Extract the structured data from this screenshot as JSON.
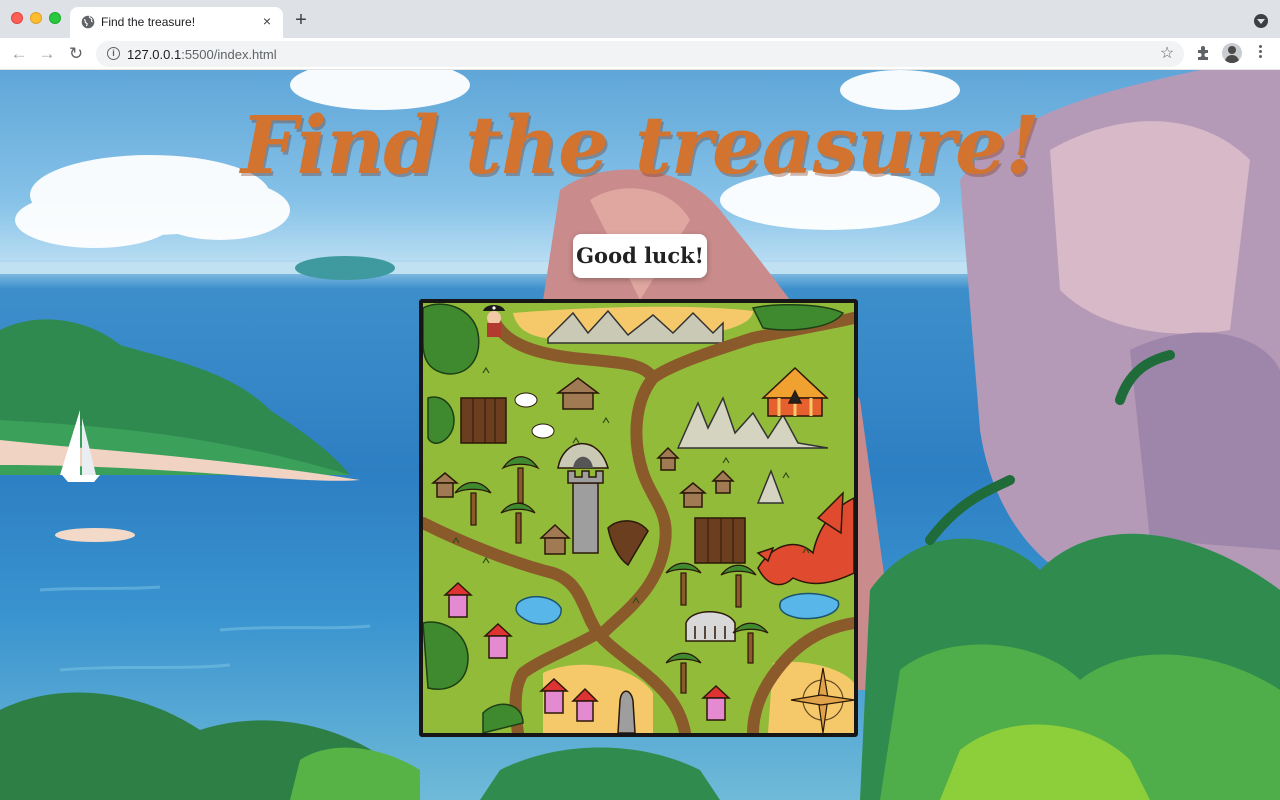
{
  "browser": {
    "tab_title": "Find the treasure!",
    "new_tab_symbol": "+",
    "close_symbol": "×",
    "url_host": "127.0.0.1",
    "url_rest": ":5500/index.html"
  },
  "page": {
    "title": "Find the treasure!",
    "status": "Good luck!"
  },
  "icons": [
    "globe-icon",
    "close-icon",
    "plus-icon",
    "tab-search-icon",
    "back-icon",
    "forward-icon",
    "reload-icon",
    "info-icon",
    "star-icon",
    "extensions-icon",
    "profile-icon",
    "menu-icon",
    "pirate-icon",
    "dragon-icon",
    "compass-icon"
  ],
  "colors": {
    "title": "#d2742f",
    "map_grass": "#93bb3a",
    "map_path": "#8b5a2b",
    "map_border": "#161616",
    "dragon": "#e04a2f"
  }
}
